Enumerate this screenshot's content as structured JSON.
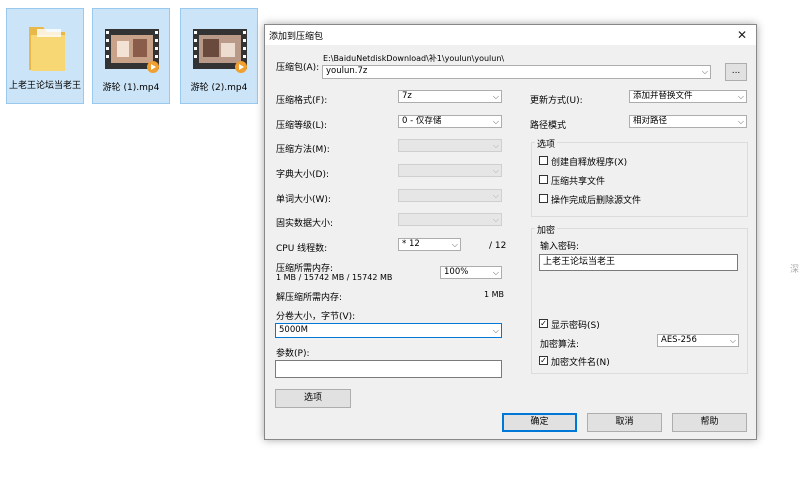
{
  "desktop": {
    "icons": [
      {
        "label": "上老王论坛当老王",
        "type": "folder"
      },
      {
        "label": "游轮 (1).mp4",
        "type": "video"
      },
      {
        "label": "游轮 (2).mp4",
        "type": "video"
      }
    ],
    "edge_text": "深"
  },
  "dialog": {
    "title": "添加到压缩包",
    "close_glyph": "✕",
    "archive_label": "压缩包(A):",
    "archive_path": "E:\\BaiduNetdiskDownload\\补1\\youlun\\youlun\\",
    "archive_name": "youlun.7z",
    "browse_label": "...",
    "format_label": "压缩格式(F):",
    "format_value": "7z",
    "level_label": "压缩等级(L):",
    "level_value": "0 - 仅存储",
    "method_label": "压缩方法(M):",
    "dict_label": "字典大小(D):",
    "word_label": "单词大小(W):",
    "solid_label": "固实数据大小:",
    "cpu_label": "CPU 线程数:",
    "cpu_value": "* 12",
    "cpu_total": "/ 12",
    "mem_comp_label": "压缩所需内存:",
    "mem_comp_value": "1 MB / 15742 MB / 15742 MB",
    "mem_percent": "100%",
    "mem_decomp_label": "解压缩所需内存:",
    "mem_decomp_value": "1 MB",
    "volume_label": "分卷大小，字节(V):",
    "volume_value": "5000M",
    "params_label": "参数(P):",
    "params_value": "",
    "options_button": "选项",
    "update_label": "更新方式(U):",
    "update_value": "添加并替换文件",
    "pathmode_label": "路径模式",
    "pathmode_value": "相对路径",
    "options_group": "选项",
    "opt_sfx": "创建自释放程序(X)",
    "opt_shared": "压缩共享文件",
    "opt_delete": "操作完成后删除源文件",
    "encrypt_group": "加密",
    "password_label": "输入密码:",
    "password_value": "上老王论坛当老王",
    "show_password": "显示密码(S)",
    "enc_method_label": "加密算法:",
    "enc_method_value": "AES-256",
    "enc_filenames": "加密文件名(N)",
    "ok_button": "确定",
    "cancel_button": "取消",
    "help_button": "帮助"
  }
}
